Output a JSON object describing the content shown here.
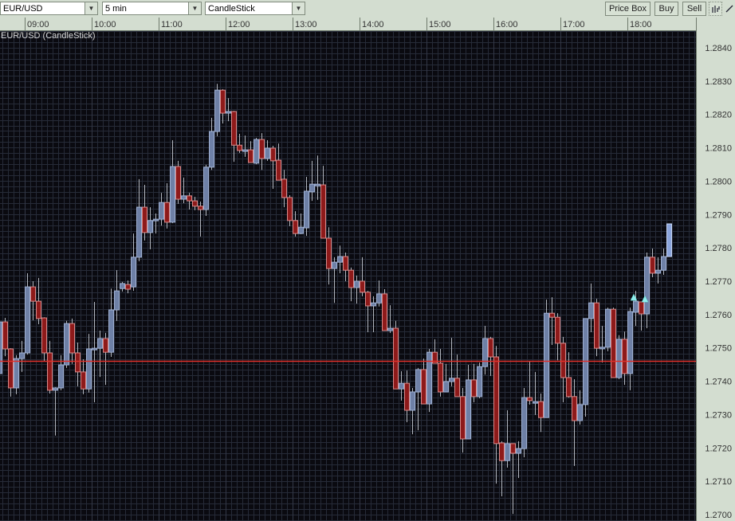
{
  "toolbar": {
    "symbol": "EUR/USD",
    "interval": "5 min",
    "chart_type": "CandleStick",
    "price_box_label": "Price Box",
    "buy_label": "Buy",
    "sell_label": "Sell",
    "icons": [
      "bar-chart-icon",
      "draw-line-icon"
    ]
  },
  "colors": {
    "background": "#0a0a10",
    "grid": "#262b38",
    "up_fill": "#6e80a6",
    "up_border": "#9fb0d2",
    "down_fill": "#8e1a1a",
    "down_border": "#d88a8a",
    "wick": "#b4b8c0",
    "price_line": "#e0302a",
    "marker": "#8ff0ee",
    "last_candle": "#8aa4dc",
    "panel": "#d3ddd0"
  },
  "chart_data": {
    "type": "candlestick",
    "title": "EUR/USD (CandleStick)",
    "xlabel": "",
    "ylabel": "",
    "x_tick_labels": [
      "09:00",
      "10:00",
      "11:00",
      "12:00",
      "13:00",
      "14:00",
      "15:00",
      "16:00",
      "17:00",
      "18:00"
    ],
    "first_tick_candle_index": 5,
    "candles_per_tick": 12,
    "y_tick_labels": [
      "1.2840",
      "1.2830",
      "1.2820",
      "1.2810",
      "1.2800",
      "1.2790",
      "1.2780",
      "1.2770",
      "1.2760",
      "1.2750",
      "1.2740",
      "1.2730",
      "1.2720",
      "1.2710",
      "1.2700"
    ],
    "ylim": [
      1.27,
      1.284
    ],
    "grid": true,
    "price_line": 1.27461,
    "markers": [
      {
        "index": 114,
        "price": 1.27652,
        "shape": "triangle-up"
      },
      {
        "index": 116,
        "price": 1.27647,
        "shape": "triangle-up"
      }
    ],
    "ohlc_fields": [
      "open",
      "high",
      "low",
      "close"
    ],
    "candles": [
      [
        1.27423,
        1.27588,
        1.27416,
        1.27578
      ],
      [
        1.27578,
        1.2759,
        1.27475,
        1.27497
      ],
      [
        1.27497,
        1.27499,
        1.27354,
        1.2738
      ],
      [
        1.2738,
        1.27478,
        1.27361,
        1.27468
      ],
      [
        1.27468,
        1.27521,
        1.27428,
        1.27485
      ],
      [
        1.27485,
        1.27724,
        1.2748,
        1.27683
      ],
      [
        1.27683,
        1.277,
        1.27583,
        1.2764
      ],
      [
        1.2764,
        1.2771,
        1.27571,
        1.27588
      ],
      [
        1.2759,
        1.27592,
        1.27461,
        1.27485
      ],
      [
        1.27485,
        1.27521,
        1.27363,
        1.27373
      ],
      [
        1.27373,
        1.27382,
        1.27237,
        1.2738
      ],
      [
        1.2738,
        1.27478,
        1.27373,
        1.27449
      ],
      [
        1.27449,
        1.27581,
        1.2744,
        1.27573
      ],
      [
        1.27573,
        1.27588,
        1.27452,
        1.27485
      ],
      [
        1.27485,
        1.27516,
        1.27385,
        1.27428
      ],
      [
        1.27428,
        1.27466,
        1.27361,
        1.27377
      ],
      [
        1.27377,
        1.27542,
        1.27366,
        1.27497
      ],
      [
        1.27497,
        1.27638,
        1.27337,
        1.27499
      ],
      [
        1.27499,
        1.27552,
        1.27413,
        1.27528
      ],
      [
        1.27528,
        1.27545,
        1.27389,
        1.27487
      ],
      [
        1.27487,
        1.27678,
        1.27473,
        1.27614
      ],
      [
        1.27614,
        1.27733,
        1.27581,
        1.27671
      ],
      [
        1.27678,
        1.27698,
        1.27669,
        1.27693
      ],
      [
        1.2769,
        1.27702,
        1.27664,
        1.27676
      ],
      [
        1.27683,
        1.27843,
        1.27671,
        1.27772
      ],
      [
        1.27772,
        1.28006,
        1.2776,
        1.27922
      ],
      [
        1.27922,
        1.27989,
        1.27822,
        1.27846
      ],
      [
        1.27846,
        1.27922,
        1.27796,
        1.27882
      ],
      [
        1.27882,
        1.27903,
        1.27843,
        1.27886
      ],
      [
        1.27886,
        1.27965,
        1.27867,
        1.27936
      ],
      [
        1.27936,
        1.27994,
        1.27858,
        1.27877
      ],
      [
        1.27877,
        1.28123,
        1.27874,
        1.28044
      ],
      [
        1.28044,
        1.28061,
        1.27932,
        1.27946
      ],
      [
        1.27946,
        1.28011,
        1.27934,
        1.27956
      ],
      [
        1.27956,
        1.27965,
        1.27915,
        1.27941
      ],
      [
        1.27941,
        1.27953,
        1.27913,
        1.27925
      ],
      [
        1.27925,
        1.27939,
        1.27834,
        1.27915
      ],
      [
        1.27915,
        1.28049,
        1.27896,
        1.28042
      ],
      [
        1.28042,
        1.2819,
        1.28034,
        1.28149
      ],
      [
        1.28149,
        1.28292,
        1.28135,
        1.28273
      ],
      [
        1.28273,
        1.28276,
        1.28173,
        1.28204
      ],
      [
        1.28204,
        1.28249,
        1.2818,
        1.28209
      ],
      [
        1.28209,
        1.28211,
        1.28058,
        1.28108
      ],
      [
        1.28108,
        1.28142,
        1.28085,
        1.28092
      ],
      [
        1.28092,
        1.28137,
        1.28073,
        1.28094
      ],
      [
        1.28094,
        1.2812,
        1.28056,
        1.28056
      ],
      [
        1.28054,
        1.2813,
        1.28051,
        1.28125
      ],
      [
        1.28125,
        1.28144,
        1.28034,
        1.28068
      ],
      [
        1.28068,
        1.28123,
        1.28061,
        1.28099
      ],
      [
        1.28099,
        1.28106,
        1.27977,
        1.28061
      ],
      [
        1.28063,
        1.28113,
        1.28003,
        1.28003
      ],
      [
        1.28006,
        1.28034,
        1.27922,
        1.27951
      ],
      [
        1.27951,
        1.27958,
        1.27865,
        1.27882
      ],
      [
        1.27882,
        1.2791,
        1.27834,
        1.27843
      ],
      [
        1.27843,
        1.27903,
        1.27841,
        1.27862
      ],
      [
        1.2786,
        1.28013,
        1.27836,
        1.2797
      ],
      [
        1.27968,
        1.28061,
        1.27941,
        1.27991
      ],
      [
        1.27989,
        1.28077,
        1.27944,
        1.27991
      ],
      [
        1.27989,
        1.28046,
        1.27829,
        1.27829
      ],
      [
        1.27829,
        1.27862,
        1.2769,
        1.27738
      ],
      [
        1.27738,
        1.27772,
        1.27635,
        1.27757
      ],
      [
        1.27757,
        1.27807,
        1.27724,
        1.27774
      ],
      [
        1.27774,
        1.27786,
        1.277,
        1.27733
      ],
      [
        1.27733,
        1.27741,
        1.2764,
        1.27681
      ],
      [
        1.27681,
        1.27717,
        1.27633,
        1.277
      ],
      [
        1.277,
        1.27772,
        1.27655,
        1.27667
      ],
      [
        1.27667,
        1.27671,
        1.27547,
        1.27626
      ],
      [
        1.27626,
        1.27655,
        1.27547,
        1.27635
      ],
      [
        1.27635,
        1.27702,
        1.27624,
        1.27662
      ],
      [
        1.27662,
        1.27676,
        1.27552,
        1.27552
      ],
      [
        1.27552,
        1.27628,
        1.27545,
        1.27559
      ],
      [
        1.27559,
        1.27581,
        1.27377,
        1.27377
      ],
      [
        1.27377,
        1.2743,
        1.27342,
        1.27394
      ],
      [
        1.27394,
        1.27432,
        1.27277,
        1.27313
      ],
      [
        1.27313,
        1.2738,
        1.27241,
        1.27368
      ],
      [
        1.27368,
        1.2744,
        1.27253,
        1.27435
      ],
      [
        1.27435,
        1.27468,
        1.27332,
        1.27332
      ],
      [
        1.27332,
        1.27497,
        1.27308,
        1.27487
      ],
      [
        1.27487,
        1.27526,
        1.27454,
        1.27454
      ],
      [
        1.27454,
        1.27497,
        1.27354,
        1.27368
      ],
      [
        1.27368,
        1.27452,
        1.27368,
        1.27399
      ],
      [
        1.27399,
        1.2753,
        1.27385,
        1.27409
      ],
      [
        1.27409,
        1.2748,
        1.27354,
        1.27354
      ],
      [
        1.27354,
        1.2738,
        1.27186,
        1.27227
      ],
      [
        1.27227,
        1.27449,
        1.27227,
        1.27404
      ],
      [
        1.27404,
        1.27452,
        1.27337,
        1.27354
      ],
      [
        1.27354,
        1.27456,
        1.27349,
        1.27444
      ],
      [
        1.27444,
        1.27566,
        1.2742,
        1.27528
      ],
      [
        1.27528,
        1.27533,
        1.27416,
        1.27473
      ],
      [
        1.27473,
        1.27506,
        1.27093,
        1.27213
      ],
      [
        1.27215,
        1.2722,
        1.27055,
        1.27162
      ],
      [
        1.27162,
        1.27313,
        1.27141,
        1.27213
      ],
      [
        1.27213,
        1.27213,
        1.27002,
        1.27184
      ],
      [
        1.27184,
        1.2722,
        1.2711,
        1.27198
      ],
      [
        1.27198,
        1.2738,
        1.27172,
        1.27351
      ],
      [
        1.27351,
        1.27461,
        1.2733,
        1.27342
      ],
      [
        1.27339,
        1.27428,
        1.27299,
        1.27339
      ],
      [
        1.27339,
        1.27363,
        1.27248,
        1.27291
      ],
      [
        1.27291,
        1.27645,
        1.27291,
        1.27604
      ],
      [
        1.27604,
        1.27652,
        1.27509,
        1.27592
      ],
      [
        1.27592,
        1.27604,
        1.27463,
        1.27514
      ],
      [
        1.27514,
        1.27533,
        1.27337,
        1.27411
      ],
      [
        1.27411,
        1.27487,
        1.27351,
        1.27354
      ],
      [
        1.27354,
        1.27406,
        1.27146,
        1.27282
      ],
      [
        1.27282,
        1.27373,
        1.2727,
        1.2733
      ],
      [
        1.2733,
        1.27588,
        1.27294,
        1.27588
      ],
      [
        1.27588,
        1.27693,
        1.27547,
        1.27635
      ],
      [
        1.27635,
        1.27647,
        1.27475,
        1.27499
      ],
      [
        1.27502,
        1.27566,
        1.27456,
        1.27502
      ],
      [
        1.27502,
        1.27621,
        1.2749,
        1.27616
      ],
      [
        1.27616,
        1.27621,
        1.27411,
        1.27411
      ],
      [
        1.27411,
        1.27538,
        1.27406,
        1.27526
      ],
      [
        1.27526,
        1.27549,
        1.27389,
        1.27423
      ],
      [
        1.27423,
        1.27621,
        1.27373,
        1.27609
      ],
      [
        1.27607,
        1.27671,
        1.27566,
        1.2764
      ],
      [
        1.27638,
        1.27638,
        1.27552,
        1.27602
      ],
      [
        1.27602,
        1.27786,
        1.27559,
        1.27772
      ],
      [
        1.27772,
        1.27798,
        1.27712,
        1.27724
      ],
      [
        1.27724,
        1.27772,
        1.27693,
        1.27733
      ],
      [
        1.27733,
        1.27798,
        1.27719,
        1.27774
      ],
      [
        1.27774,
        1.27872,
        1.27774,
        1.27872
      ]
    ]
  }
}
